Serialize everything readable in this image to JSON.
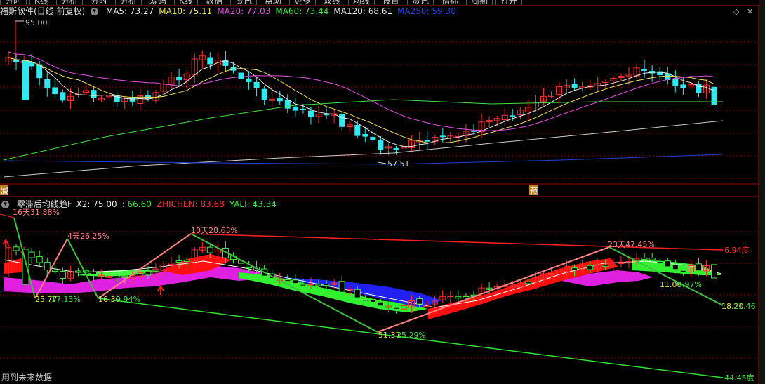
{
  "top_tabs": [
    "分时",
    "K线",
    "分析",
    "分时",
    "分析",
    "筹码",
    "K线",
    "数据",
    "资讯",
    "帮助",
    "更多",
    "双线",
    "均线",
    "设置",
    "资讯",
    "指标",
    "周期",
    "打开"
  ],
  "main": {
    "title": "福斯软件(日线 前复权)",
    "ma_items": [
      {
        "label": "MA5: 73.27",
        "color": "#e8e8e8"
      },
      {
        "label": "MA10: 75.11",
        "color": "#f0e060"
      },
      {
        "label": "MA20: 77.03",
        "color": "#e050e0"
      },
      {
        "label": "MA60: 73.44",
        "color": "#40e040"
      },
      {
        "label": "MA120: 68.61",
        "color": "#e8e8e8"
      },
      {
        "label": "MA250: 59.30",
        "color": "#2040e0"
      }
    ],
    "high_label": "95.00",
    "low_label": "57.51",
    "marker_left": "减",
    "marker_right": "预"
  },
  "sub": {
    "title": "零滞后均线趋F",
    "items": [
      {
        "label": "X2: 75.00",
        "color": "#e8e8e8"
      },
      {
        "label": ": 66.60",
        "color": "#40e040"
      },
      {
        "label": "ZHICHEN: 83.68",
        "color": "#ff3030"
      },
      {
        "label": "YALI: 43.34",
        "color": "#40e040"
      }
    ],
    "annotations": [
      {
        "text": "16天31.88%",
        "color": "#ff8080"
      },
      {
        "text": "4天26.25%",
        "color": "#ff8080"
      },
      {
        "text": "10天28.63%",
        "color": "#ff8080"
      },
      {
        "text": "23天47.45%",
        "color": "#ff8080"
      },
      {
        "text": "25.77",
        "color": "#e0e040"
      },
      {
        "text": "17.13%",
        "color": "#40e040"
      },
      {
        "text": "16.30",
        "color": "#e0e040"
      },
      {
        "text": "9.94%",
        "color": "#40e040"
      },
      {
        "text": "51.37",
        "color": "#e0e040"
      },
      {
        "text": "25.29%",
        "color": "#40e040"
      },
      {
        "text": "11.00",
        "color": "#e0e040"
      },
      {
        "text": "9.97%",
        "color": "#40e040"
      },
      {
        "text": "18.20",
        "color": "#e0e040"
      },
      {
        "text": "21.46",
        "color": "#40e040"
      }
    ],
    "red_line_label": "6.94度",
    "green_line_label": "44.45度"
  },
  "footer": "用到未来数据",
  "colors": {
    "up": "#ff3030",
    "down": "#30e8f0",
    "grid": "#7a0000",
    "bg": "#000000"
  }
}
